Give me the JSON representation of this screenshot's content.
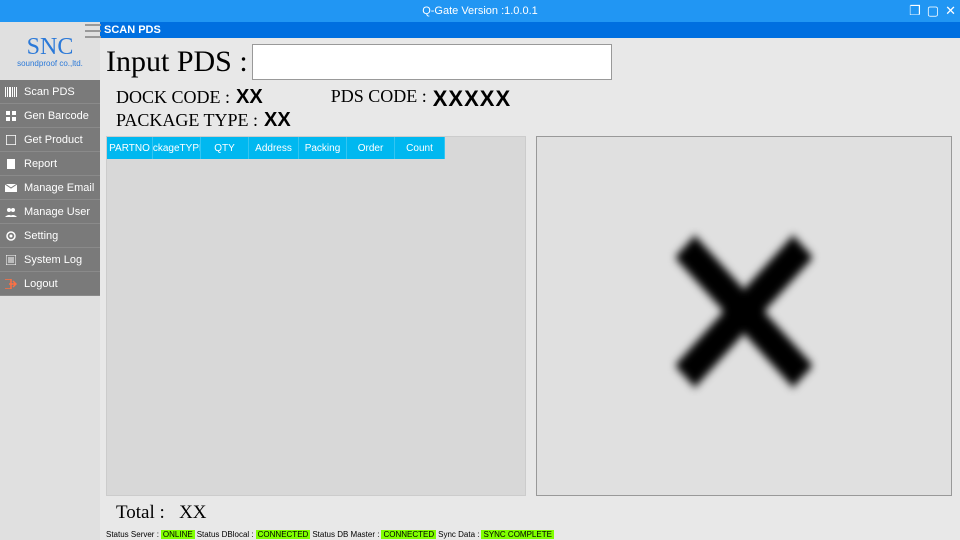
{
  "title_bar": {
    "title": "Q-Gate Version :1.0.0.1"
  },
  "sub_title": "SCAN PDS",
  "logo": {
    "main": "SNC",
    "sub": "soundproof co.,ltd."
  },
  "sidebar": {
    "items": [
      {
        "label": "Scan PDS",
        "icon": "barcode"
      },
      {
        "label": "Gen Barcode",
        "icon": "grid"
      },
      {
        "label": "Get Product",
        "icon": "box"
      },
      {
        "label": "Report",
        "icon": "doc"
      },
      {
        "label": "Manage Email",
        "icon": "mail"
      },
      {
        "label": "Manage User",
        "icon": "users"
      },
      {
        "label": "Setting",
        "icon": "gear"
      },
      {
        "label": "System Log",
        "icon": "log"
      },
      {
        "label": "Logout",
        "icon": "logout"
      }
    ]
  },
  "main": {
    "input_label": "Input PDS :",
    "input_value": "",
    "dock_code_label": "DOCK CODE :",
    "dock_code_value": "XX",
    "package_type_label": "PACKAGE TYPE :",
    "package_type_value": "XX",
    "pds_code_label": "PDS CODE :",
    "pds_code_value": "XXXXX",
    "table_headers": [
      "PARTNO",
      "ackageTYPE",
      "QTY",
      "Address",
      "Packing",
      "Order",
      "Count"
    ],
    "total_label": "Total :",
    "total_value": "XX"
  },
  "status": {
    "server_label": "Status Server :",
    "server_value": "ONLINE",
    "dblocal_label": "Status DBlocal :",
    "dblocal_value": "CONNECTED",
    "dbmaster_label": "Status DB Master :",
    "dbmaster_value": "CONNECTED",
    "sync_label": "Sync Data :",
    "sync_value": "SYNC COMPLETE"
  }
}
